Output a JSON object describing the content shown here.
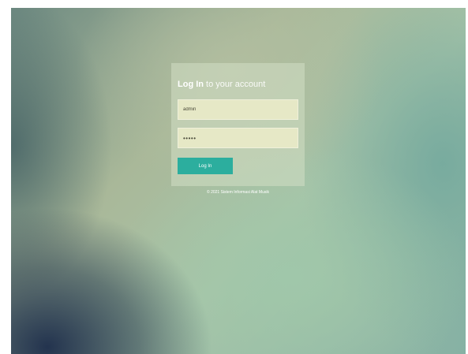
{
  "login": {
    "title_strong": "Log In",
    "title_rest": " to your account",
    "username_value": "admin",
    "password_value": "•••••",
    "button_label": "Log In"
  },
  "footer": {
    "text": "© 2021 Sistem Informasi Alat Musik"
  },
  "colors": {
    "button": "#2cae9e",
    "field_bg": "#e6e8c6",
    "text": "#ffffff"
  }
}
